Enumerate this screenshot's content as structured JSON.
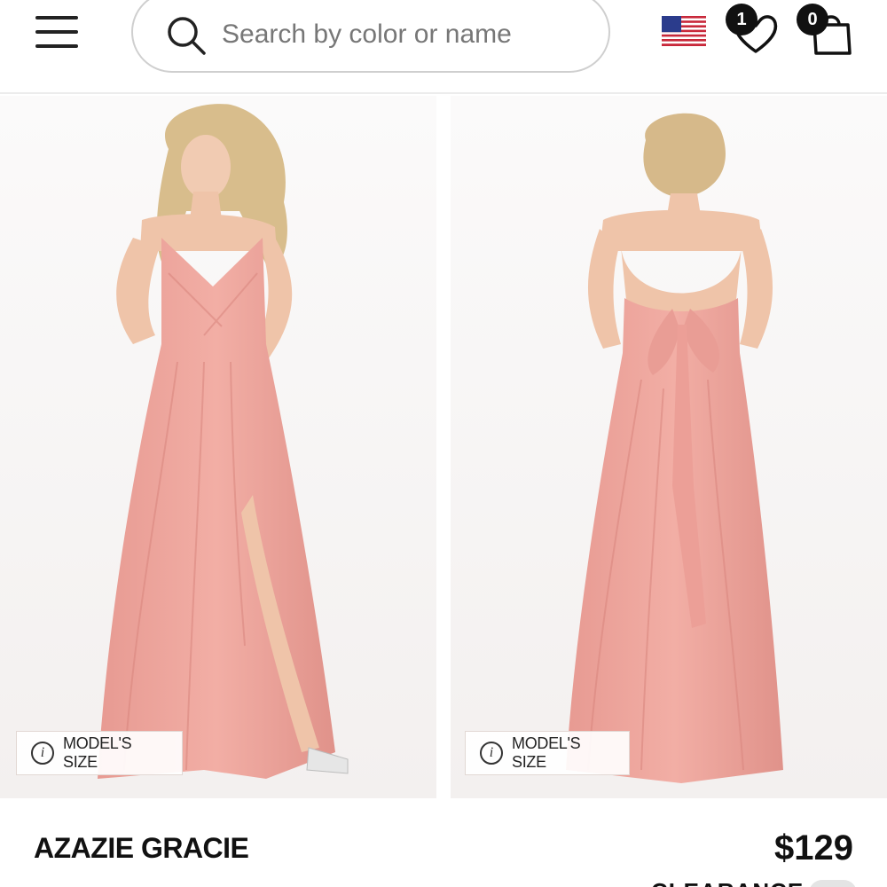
{
  "search": {
    "placeholder": "Search by color or name"
  },
  "header": {
    "wishlist_count": "1",
    "cart_count": "0",
    "region_flag": "us-flag-icon"
  },
  "gallery": {
    "images": [
      {
        "view": "front",
        "model_size_label": "MODEL'S SIZE"
      },
      {
        "view": "back",
        "model_size_label": "MODEL'S SIZE"
      }
    ],
    "dress_color": "#eea59c"
  },
  "product": {
    "name": "AZAZIE GRACIE",
    "price": "$129",
    "clearance_label": "CLEARANCE"
  },
  "colors": {
    "accent": "#111111",
    "badge": "#111111",
    "border": "#cfcfcf"
  }
}
